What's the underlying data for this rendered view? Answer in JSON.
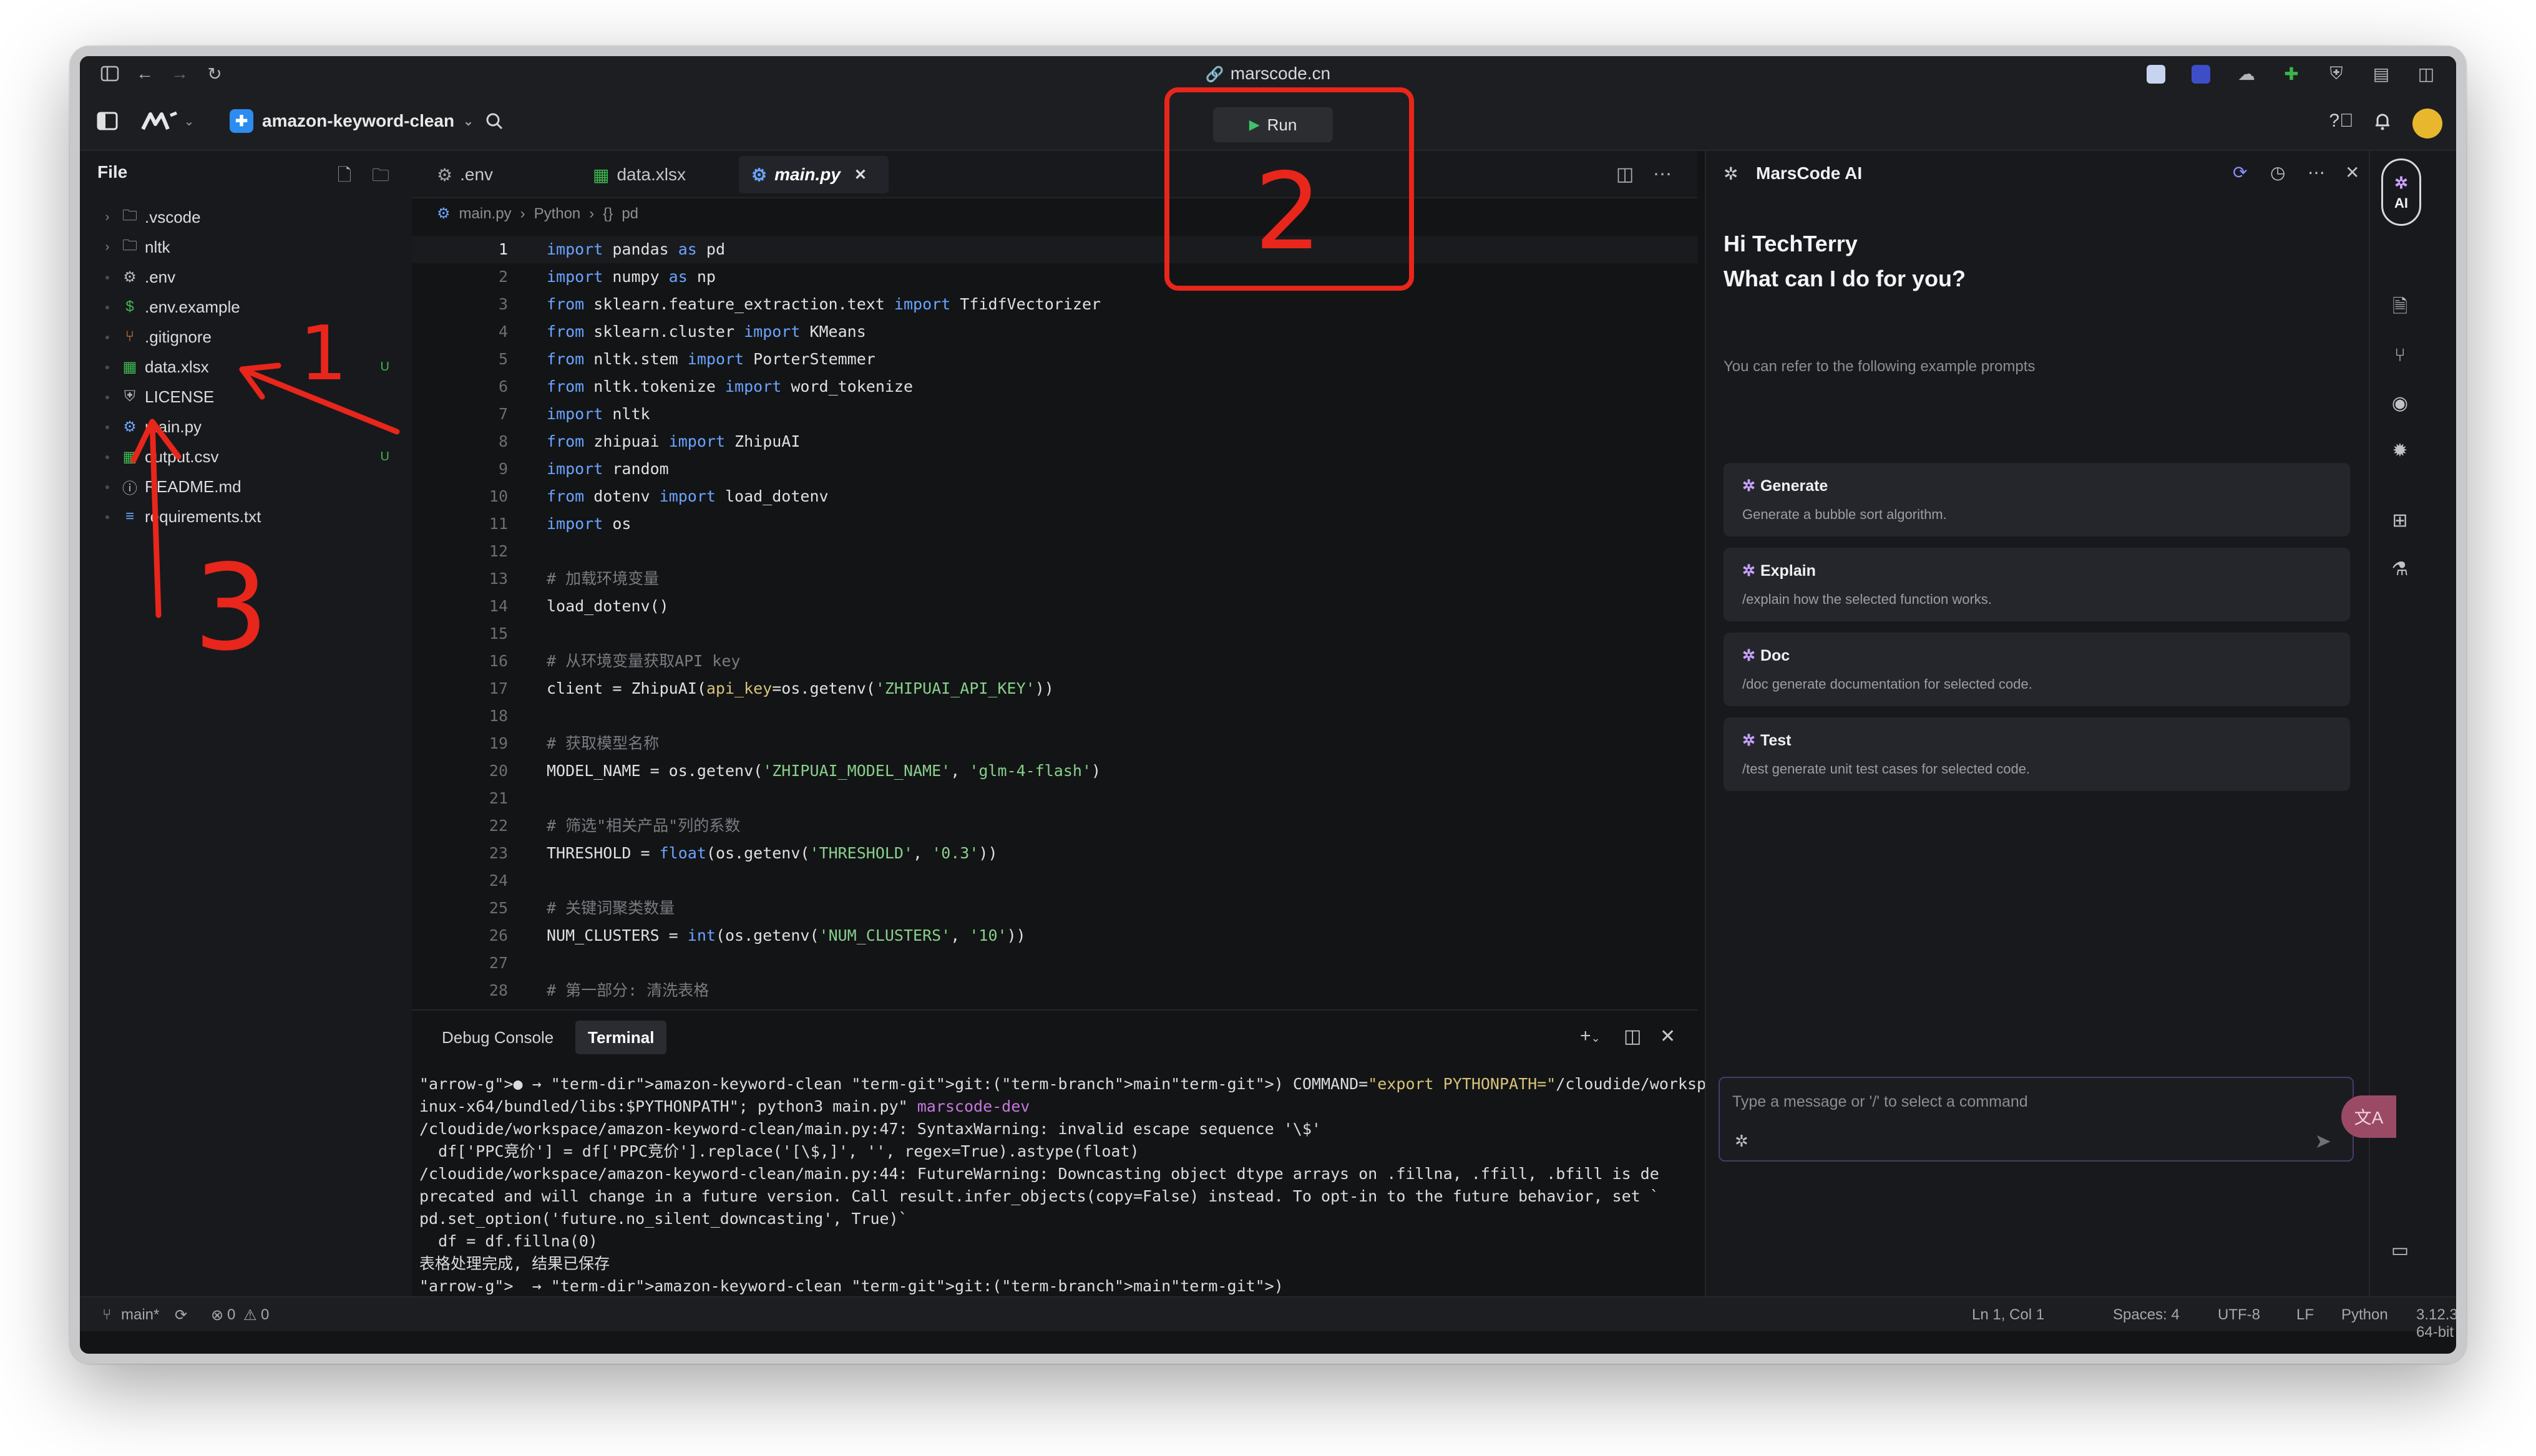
{
  "browser": {
    "url": "marscode.cn",
    "sidebar_toggle": "sidebar-toggle",
    "back": "back",
    "forward": "forward",
    "reload": "reload"
  },
  "app": {
    "project_name": "amazon-keyword-clean",
    "run_label": "Run"
  },
  "explorer": {
    "title": "File",
    "items": [
      {
        "name": ".vscode",
        "kind": "folder",
        "badge": ""
      },
      {
        "name": "nltk",
        "kind": "folder",
        "badge": ""
      },
      {
        "name": ".env",
        "kind": "gear",
        "badge": ""
      },
      {
        "name": ".env.example",
        "kind": "dollar",
        "badge": ""
      },
      {
        "name": ".gitignore",
        "kind": "git",
        "badge": ""
      },
      {
        "name": "data.xlsx",
        "kind": "excel",
        "badge": "U"
      },
      {
        "name": "LICENSE",
        "kind": "license",
        "badge": ""
      },
      {
        "name": "main.py",
        "kind": "python",
        "badge": ""
      },
      {
        "name": "output.csv",
        "kind": "csv",
        "badge": "U"
      },
      {
        "name": "README.md",
        "kind": "info",
        "badge": ""
      },
      {
        "name": "requirements.txt",
        "kind": "text",
        "badge": ""
      }
    ]
  },
  "editor": {
    "tabs": [
      {
        "label": ".env"
      },
      {
        "label": "data.xlsx"
      },
      {
        "label": "main.py"
      }
    ],
    "breadcrumb": [
      "main.py",
      "Python",
      "pd"
    ],
    "lines": [
      "import pandas as pd",
      "import numpy as np",
      "from sklearn.feature_extraction.text import TfidfVectorizer",
      "from sklearn.cluster import KMeans",
      "from nltk.stem import PorterStemmer",
      "from nltk.tokenize import word_tokenize",
      "import nltk",
      "from zhipuai import ZhipuAI",
      "import random",
      "from dotenv import load_dotenv",
      "import os",
      "",
      "# 加载环境变量",
      "load_dotenv()",
      "",
      "# 从环境变量获取API key",
      "client = ZhipuAI(api_key=os.getenv('ZHIPUAI_API_KEY'))",
      "",
      "# 获取模型名称",
      "MODEL_NAME = os.getenv('ZHIPUAI_MODEL_NAME', 'glm-4-flash')",
      "",
      "# 筛选\"相关产品\"列的系数",
      "THRESHOLD = float(os.getenv('THRESHOLD', '0.3'))",
      "",
      "# 关键词聚类数量",
      "NUM_CLUSTERS = int(os.getenv('NUM_CLUSTERS', '10'))",
      "",
      "# 第一部分: 清洗表格"
    ]
  },
  "terminal": {
    "tabs": [
      "Debug Console",
      "Terminal"
    ],
    "lines": [
      "→ amazon-keyword-clean git:(main) COMMAND=\"export PYTHONPATH=\"/cloudide/workspace/.cloudide/extensions/ms-python.debugpy-2024.0.0-l",
      "inux-x64/bundled/libs:$PYTHONPATH\"; python3 main.py\" marscode-dev",
      "/cloudide/workspace/amazon-keyword-clean/main.py:47: SyntaxWarning: invalid escape sequence '\\$'",
      "  df['PPC竞价'] = df['PPC竞价'].replace('[\\$,]', '', regex=True).astype(float)",
      "/cloudide/workspace/amazon-keyword-clean/main.py:44: FutureWarning: Downcasting object dtype arrays on .fillna, .ffill, .bfill is de",
      "precated and will change in a future version. Call result.infer_objects(copy=False) instead. To opt-in to the future behavior, set `",
      "pd.set_option('future.no_silent_downcasting', True)`",
      "  df = df.fillna(0)",
      "表格处理完成, 结果已保存",
      "→ amazon-keyword-clean git:(main)"
    ]
  },
  "ai": {
    "title": "MarsCode AI",
    "greeting_line1": "Hi TechTerry",
    "greeting_line2": "What can I do for you?",
    "hint": "You can refer to the following example prompts",
    "cards": [
      {
        "title": "Generate",
        "desc": "Generate a bubble sort algorithm."
      },
      {
        "title": "Explain",
        "desc": "/explain how the selected function works."
      },
      {
        "title": "Doc",
        "desc": "/doc generate documentation for selected code."
      },
      {
        "title": "Test",
        "desc": "/test generate unit test cases for selected code."
      }
    ],
    "input_placeholder": "Type a message or '/' to select a command",
    "activity_label": "AI"
  },
  "status": {
    "branch": "main*",
    "errors": "0",
    "warnings": "0",
    "position": "Ln 1, Col 1",
    "spaces": "Spaces: 4",
    "encoding": "UTF-8",
    "eol": "LF",
    "language": "Python",
    "interpreter": "3.12.3 64-bit"
  },
  "annotations": {
    "marks": [
      "1",
      "2",
      "3"
    ],
    "color": "#e8261b"
  },
  "colors": {
    "accent_ai": "#c9a2ff",
    "git_untracked": "#3fb950",
    "run_icon": "#3fc36b"
  }
}
